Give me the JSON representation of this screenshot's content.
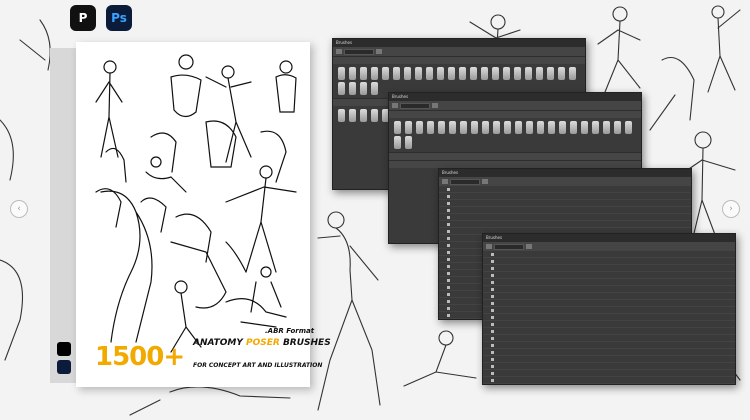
{
  "apps": {
    "procreate": {
      "label": "P",
      "icon": "procreate-icon"
    },
    "photoshop": {
      "label": "Ps",
      "icon": "photoshop-icon"
    }
  },
  "product": {
    "count": "1500+",
    "line1_prefix": "ANATOMY ",
    "line1_highlight": "POSER",
    "line1_suffix": " BRUSHES",
    "line2": "FOR CONCEPT ART AND ILLUSTRATION",
    "format": ".ABR Format",
    "accent": "#f2a900"
  },
  "windows": [
    {
      "title": "Brushes"
    },
    {
      "title": "Brushes"
    },
    {
      "title": "Brushes"
    },
    {
      "title": "Brushes"
    }
  ],
  "nav": {
    "prev": "‹",
    "next": "›"
  }
}
